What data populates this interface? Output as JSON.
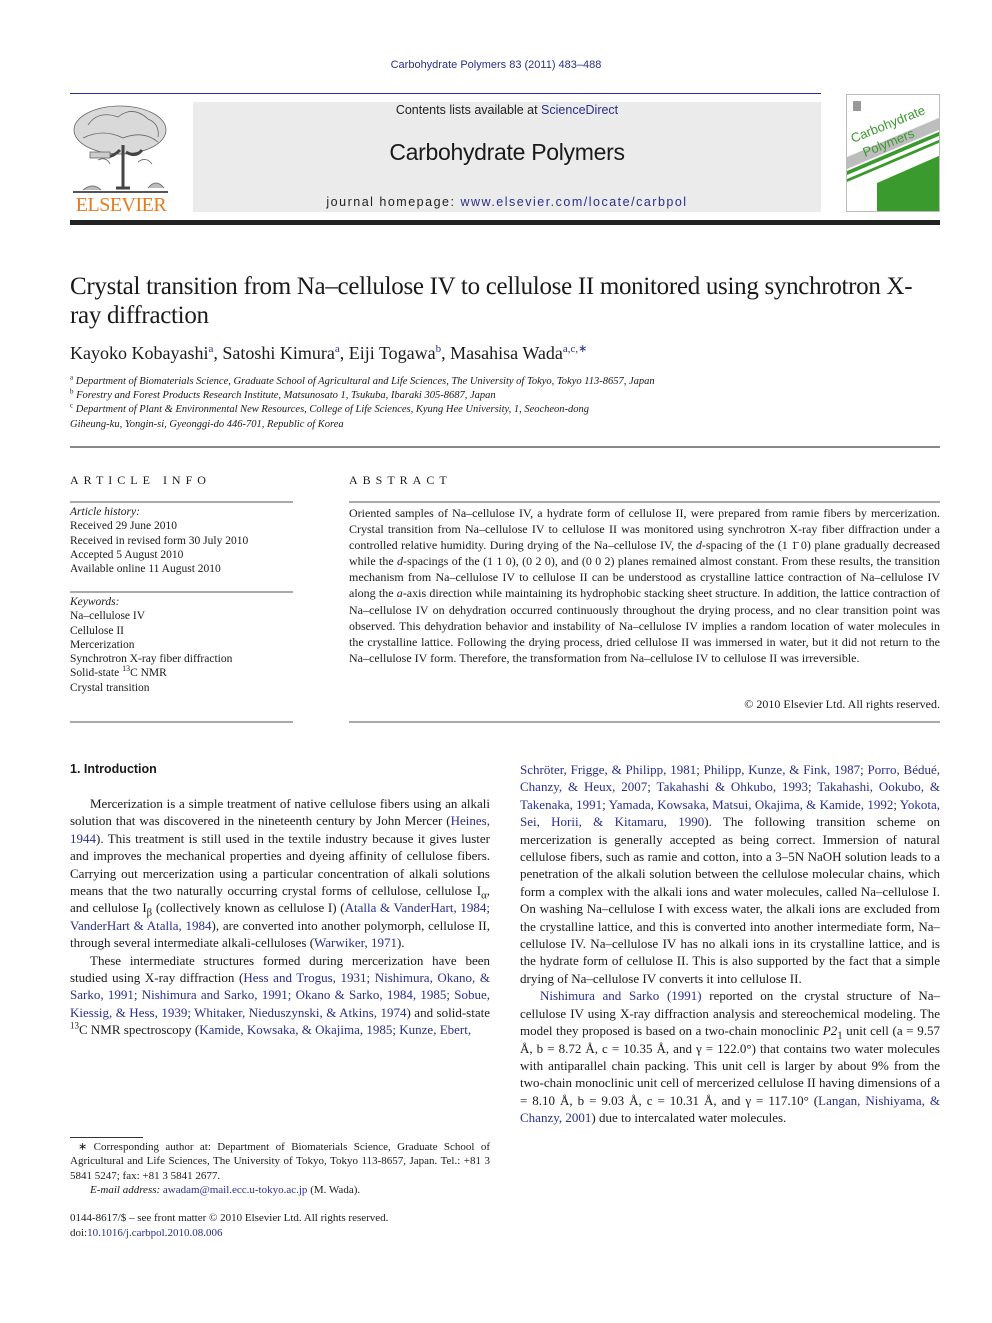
{
  "header": {
    "journal_reference": "Carbohydrate Polymers 83 (2011) 483–488",
    "contents_prefix": "Contents lists available at ",
    "contents_link": "ScienceDirect",
    "journal_title": "Carbohydrate Polymers",
    "homepage_prefix": "journal homepage: ",
    "homepage_link": "www.elsevier.com/locate/carbpol",
    "publisher_wordmark": "ELSEVIER",
    "cover": {
      "title_line1": "Carbohydrate",
      "title_line2": "Polymers"
    },
    "colors": {
      "link_blue": "#2a2f8a",
      "elsevier_orange": "#e87a1d",
      "cover_green": "#3a9a2e",
      "masthead_gray": "#ebebeb"
    }
  },
  "article": {
    "title": "Crystal transition from Na–cellulose IV to cellulose II monitored using synchrotron X-ray diffraction",
    "authors": [
      {
        "name": "Kayoko Kobayashi",
        "affil": "a"
      },
      {
        "name": "Satoshi Kimura",
        "affil": "a"
      },
      {
        "name": "Eiji Togawa",
        "affil": "b"
      },
      {
        "name": "Masahisa Wada",
        "affil": "a,c,∗"
      }
    ],
    "affiliations": [
      {
        "mark": "a",
        "text": "Department of Biomaterials Science, Graduate School of Agricultural and Life Sciences, The University of Tokyo, Tokyo 113-8657, Japan"
      },
      {
        "mark": "b",
        "text": "Forestry and Forest Products Research Institute, Matsunosato 1, Tsukuba, Ibaraki 305-8687, Japan"
      },
      {
        "mark": "c",
        "text": "Department of Plant & Environmental New Resources, College of Life Sciences, Kyung Hee University, 1, Seocheon-dong"
      },
      {
        "mark": "",
        "text": "Giheung-ku, Yongin-si, Gyeonggi-do 446-701, Republic of Korea"
      }
    ]
  },
  "article_info": {
    "heading": "ARTICLE INFO",
    "history_label": "Article history:",
    "history": [
      "Received 29 June 2010",
      "Received in revised form 30 July 2010",
      "Accepted 5 August 2010",
      "Available online 11 August 2010"
    ],
    "keywords_label": "Keywords:",
    "keywords": [
      "Na–cellulose IV",
      "Cellulose II",
      "Mercerization",
      "Synchrotron X-ray fiber diffraction",
      "Solid-state ",
      "Crystal transition"
    ],
    "keyword_nmr_sup": "13",
    "keyword_nmr_rest": "C NMR"
  },
  "abstract": {
    "heading": "ABSTRACT",
    "p1": "Oriented samples of Na–cellulose IV, a hydrate form of cellulose II, were prepared from ramie fibers by mercerization. Crystal transition from Na–cellulose IV to cellulose II was monitored using synchrotron X-ray fiber diffraction under a controlled relative humidity. During drying of the Na–cellulose IV, the ",
    "d1": "d",
    "p2": "-spacing of the (1 1̄ 0) plane gradually decreased while the ",
    "d2": "d",
    "p3": "-spacings of the (1 1 0), (0 2 0), and (0 0 2) planes remained almost constant. From these results, the transition mechanism from Na–cellulose IV to cellulose II can be understood as crystalline lattice contraction of Na–cellulose IV along the ",
    "a_axis": "a",
    "p4": "-axis direction while maintaining its hydrophobic stacking sheet structure. In addition, the lattice contraction of Na–cellulose IV on dehydration occurred continuously throughout the drying process, and no clear transition point was observed. This dehydration behavior and instability of Na–cellulose IV implies a random location of water molecules in the crystalline lattice. Following the drying process, dried cellulose II was immersed in water, but it did not return to the Na–cellulose IV form. Therefore, the transformation from Na–cellulose IV to cellulose II was irreversible.",
    "copyright": "© 2010 Elsevier Ltd. All rights reserved."
  },
  "introduction": {
    "heading": "1.  Introduction",
    "left": {
      "p1_a": "Mercerization is a simple treatment of native cellulose fibers using an alkali solution that was discovered in the nineteenth century by John Mercer (",
      "p1_ref1": "Heines, 1944",
      "p1_b": "). This treatment is still used in the textile industry because it gives luster and improves the mechanical properties and dyeing affinity of cellulose fibers. Carrying out mercerization using a particular concentration of alkali solutions means that the two naturally occurring crystal forms of cellulose, cellulose I",
      "sub_alpha": "α",
      "p1_c": ", and cellulose I",
      "sub_beta": "β",
      "p1_d": " (collectively known as cellulose I) (",
      "p1_ref2": "Atalla & VanderHart, 1984; VanderHart & Atalla, 1984",
      "p1_e": "), are converted into another polymorph, cellulose II, through several intermediate alkali-celluloses (",
      "p1_ref3": "Warwiker, 1971",
      "p1_f": ").",
      "p2_a": "These intermediate structures formed during mercerization have been studied using X-ray diffraction (",
      "p2_ref1": "Hess and Trogus, 1931; Nishimura, Okano, & Sarko, 1991; Nishimura and Sarko, 1991; Okano & Sarko, 1984, 1985; Sobue, Kiessig, & Hess, 1939; Whitaker, Nieduszynski, & Atkins, 1974",
      "p2_b": ") and solid-state ",
      "p2_sup": "13",
      "p2_c": "C NMR spectroscopy (",
      "p2_ref2": "Kamide, Kowsaka, & Okajima, 1985; Kunze, Ebert,"
    },
    "right": {
      "p1_ref": "Schröter, Frigge, & Philipp, 1981; Philipp, Kunze, & Fink, 1987; Porro, Bédué, Chanzy, & Heux, 2007; Takahashi & Ohkubo, 1993; Takahashi, Ookubo, & Takenaka, 1991; Yamada, Kowsaka, Matsui, Okajima, & Kamide, 1992; Yokota, Sei, Horii, & Kitamaru, 1990",
      "p1_b": "). The following transition scheme on mercerization is generally accepted as being correct. Immersion of natural cellulose fibers, such as ramie and cotton, into a 3–5N NaOH solution leads to a penetration of the alkali solution between the cellulose molecular chains, which form a complex with the alkali ions and water molecules, called Na–cellulose I. On washing Na–cellulose I with excess water, the alkali ions are excluded from the crystalline lattice, and this is converted into another intermediate form, Na–cellulose IV. Na–cellulose IV has no alkali ions in its crystalline lattice, and is the hydrate form of cellulose II. This is also supported by the fact that a simple drying of Na–cellulose IV converts it into cellulose II.",
      "p2_ref1": "Nishimura and Sarko (1991)",
      "p2_a": " reported on the crystal structure of Na–cellulose IV using X-ray diffraction analysis and stereochemical modeling. The model they proposed is based on a two-chain monoclinic ",
      "p2_group": "P2",
      "p2_group_sub": "1",
      "p2_b": " unit cell (",
      "p2_cell1": "a = 9.57 Å, b = 8.72 Å, c = 10.35 Å, and γ = 122.0°",
      "p2_c": ") that contains two water molecules with antiparallel chain packing. This unit cell is larger by about 9% from the two-chain monoclinic unit cell of mercerized cellulose II having dimensions of ",
      "p2_cell2": "a = 8.10 Å, b = 9.03 Å, c = 10.31 Å, and γ = 117.10°",
      "p2_d": " (",
      "p2_ref2": "Langan, Nishiyama, & Chanzy, 2001",
      "p2_e": ") due to intercalated water molecules."
    }
  },
  "footnote": {
    "corresponding": "∗ Corresponding author at: Department of Biomaterials Science, Graduate School of Agricultural and Life Sciences, The University of Tokyo, Tokyo 113-8657, Japan. Tel.: +81 3 5841 5247; fax: +81 3 5841 2677.",
    "email_label": "E-mail address: ",
    "email": "awadam@mail.ecc.u-tokyo.ac.jp",
    "email_suffix": " (M. Wada).",
    "issn_line": "0144-8617/$ – see front matter © 2010 Elsevier Ltd. All rights reserved.",
    "doi_prefix": "doi:",
    "doi": "10.1016/j.carbpol.2010.08.006"
  }
}
